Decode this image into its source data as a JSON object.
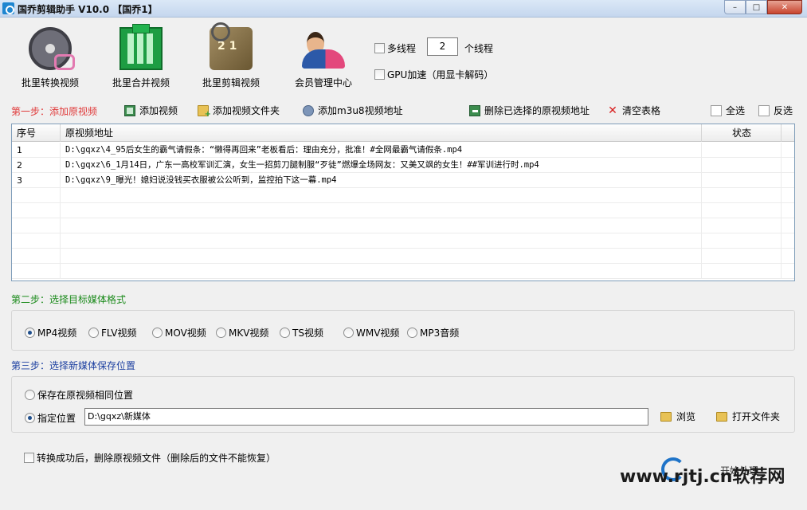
{
  "window": {
    "title": "国乔剪辑助手 V10.0  【国乔1】",
    "minimize_glyph": "–",
    "maximize_glyph": "□",
    "close_glyph": "✕"
  },
  "toolbar": {
    "batch_convert": "批里转换视频",
    "batch_merge": "批里合并视频",
    "batch_cut": "批里剪辑视频",
    "member_center": "会员管理中心"
  },
  "options": {
    "multithread_label": "多线程",
    "thread_count": "2",
    "thread_unit": "个线程",
    "gpu_label": "GPU加速（用显卡解码）"
  },
  "step1": {
    "title": "第一步：添加原视频",
    "title_color": "#e03a3a",
    "add_video": "添加视频",
    "add_folder": "添加视频文件夹",
    "add_m3u8": "添加m3u8视频地址",
    "delete_selected": "删除已选择的原视频地址",
    "clear_table": "清空表格",
    "select_all": "全选",
    "invert": "反选"
  },
  "grid": {
    "columns": {
      "index": "序号",
      "path": "原视频地址",
      "status": "状态"
    },
    "rows": [
      {
        "index": "1",
        "path": "D:\\gqxz\\4_95后女生的霸气请假条：“懒得再回来”老板看后：理由充分，批准！#全网最霸气请假条.mp4",
        "status": ""
      },
      {
        "index": "2",
        "path": "D:\\gqxz\\6_1月14日，广东一高校军训汇演，女生一招剪刀腿制服“歹徒”燃爆全场网友：又美又飒的女生！##军训进行时.mp4",
        "status": ""
      },
      {
        "index": "3",
        "path": "D:\\gqxz\\9_曝光！媳妇说没钱买衣服被公公听到，监控拍下这一幕.mp4",
        "status": ""
      }
    ]
  },
  "step2": {
    "title": "第二步：选择目标媒体格式",
    "title_color": "#1a8a1a",
    "formats": [
      "MP4视频",
      "FLV视频",
      "MOV视频",
      "MKV视频",
      "TS视频",
      "WMV视频",
      "MP3音频"
    ],
    "selected": "MP4视频"
  },
  "step3": {
    "title": "第三步：选择新媒体保存位置",
    "title_color": "#1c3fa0",
    "same_location": "保存在原视频相同位置",
    "custom_location": "指定位置",
    "path": "D:\\gqxz\\新媒体",
    "browse": "浏览",
    "open_folder": "打开文件夹"
  },
  "footer": {
    "delete_after": "转换成功后，删除原视频文件（删除后的文件不能恢复）",
    "partial_button": "开始处理"
  },
  "watermark": {
    "text": "www.rjtj.cn软荐网"
  }
}
